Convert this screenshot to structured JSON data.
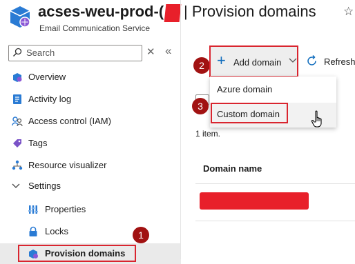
{
  "header": {
    "resource_name": "acses-weu-prod-",
    "resource_suffix": "(",
    "separator": "|",
    "page_title": "Provision domains",
    "subtitle": "Email Communication Service",
    "favorite_icon": "star-icon"
  },
  "sidebar": {
    "search_placeholder": "Search",
    "items": [
      {
        "label": "Overview",
        "icon": "overview-icon"
      },
      {
        "label": "Activity log",
        "icon": "activity-log-icon"
      },
      {
        "label": "Access control (IAM)",
        "icon": "iam-icon"
      },
      {
        "label": "Tags",
        "icon": "tag-icon"
      },
      {
        "label": "Resource visualizer",
        "icon": "visualizer-icon"
      },
      {
        "label": "Settings",
        "icon": "chevron-down-icon"
      },
      {
        "label": "Properties",
        "icon": "properties-icon"
      },
      {
        "label": "Locks",
        "icon": "lock-icon"
      },
      {
        "label": "Provision domains",
        "icon": "provision-domains-icon",
        "selected": true
      }
    ]
  },
  "toolbar": {
    "add_domain_label": "Add domain",
    "refresh_label": "Refresh"
  },
  "dropdown": {
    "items": [
      "Azure domain",
      "Custom domain"
    ]
  },
  "list": {
    "count_text": "1 item.",
    "column_header": "Domain name"
  },
  "annotations": {
    "step1": "1",
    "step2": "2",
    "step3": "3",
    "color": "#a11212"
  },
  "colors": {
    "highlight_border": "#d9252f",
    "redaction": "#e8202a",
    "accent": "#0f6cbd"
  }
}
